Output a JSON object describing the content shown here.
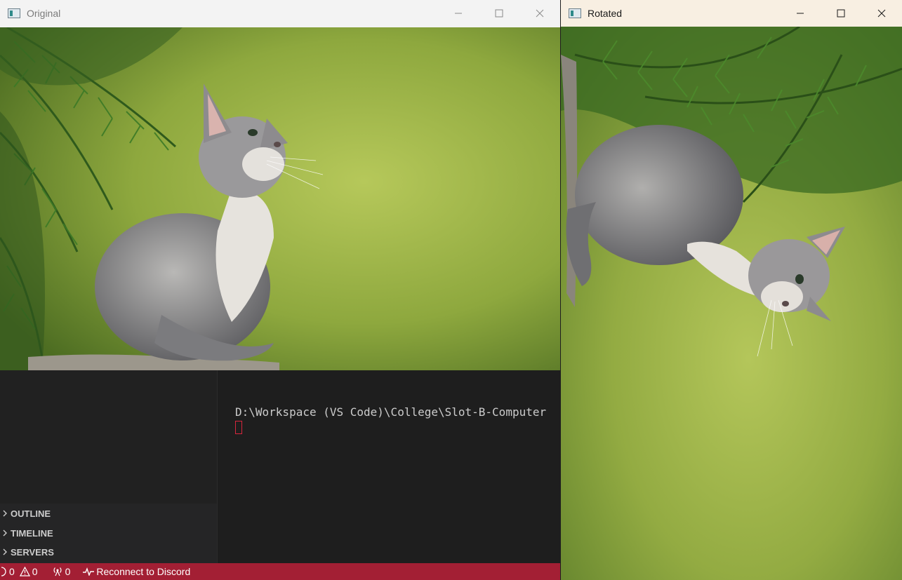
{
  "windows": {
    "original": {
      "title": "Original",
      "icon": "app-window-icon",
      "controls": [
        "minimize-icon",
        "maximize-icon",
        "close-icon"
      ]
    },
    "rotated": {
      "title": "Rotated",
      "icon": "app-window-icon",
      "controls": [
        "minimize-icon",
        "maximize-icon",
        "close-icon"
      ]
    }
  },
  "vscode": {
    "terminal": {
      "path_line": "D:\\Workspace (VS Code)\\College\\Slot-B-Computer"
    },
    "sidebar": {
      "sections": [
        {
          "label": "OUTLINE"
        },
        {
          "label": "TIMELINE"
        },
        {
          "label": "SERVERS"
        }
      ]
    },
    "statusbar": {
      "errors": "0",
      "warnings": "0",
      "ports": "0",
      "discord_label": "Reconnect to Discord",
      "bg_color": "#a31f34"
    }
  }
}
